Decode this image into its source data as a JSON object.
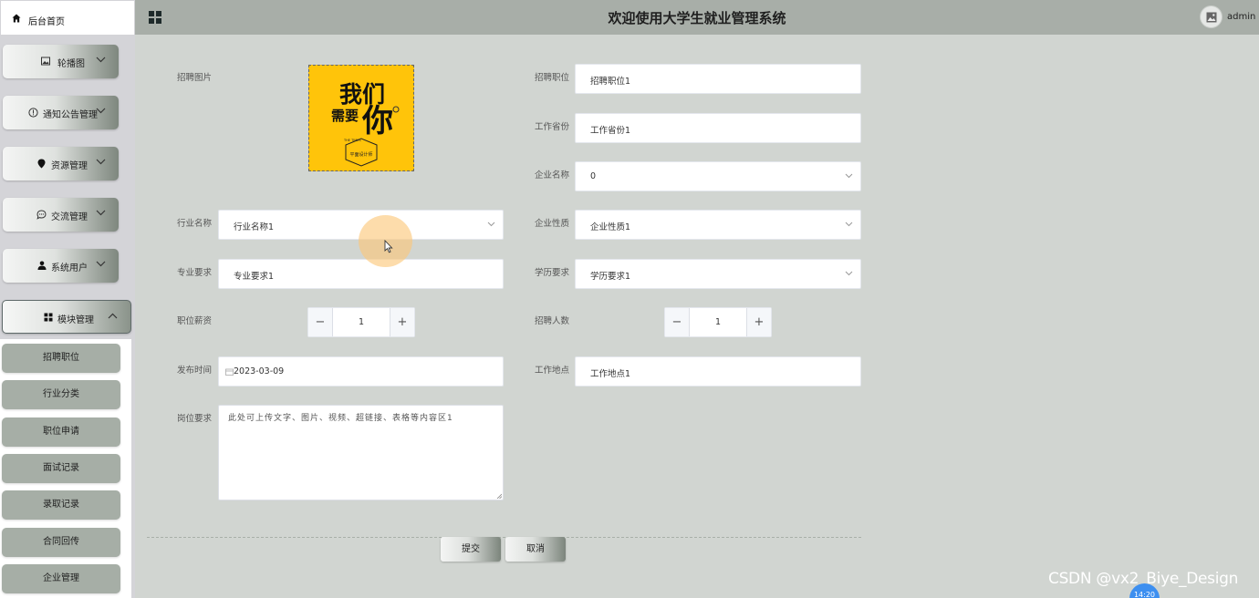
{
  "header": {
    "title": "欢迎使用大学生就业管理系统",
    "user": "admin"
  },
  "sidebar": {
    "home": "后台首页",
    "menus": [
      {
        "label": "轮播图",
        "icon": "image-icon"
      },
      {
        "label": "通知公告管理",
        "icon": "info-icon"
      },
      {
        "label": "资源管理",
        "icon": "location-pin-icon"
      },
      {
        "label": "交流管理",
        "icon": "chat-icon"
      },
      {
        "label": "系统用户",
        "icon": "user-icon"
      },
      {
        "label": "模块管理",
        "icon": "grid-icon"
      }
    ],
    "submenu": [
      "招聘职位",
      "行业分类",
      "职位申请",
      "面试记录",
      "录取记录",
      "合同回传",
      "企业管理"
    ]
  },
  "form": {
    "labels": {
      "image": "招聘图片",
      "position": "招聘职位",
      "province": "工作省份",
      "company": "企业名称",
      "industry": "行业名称",
      "nature": "企业性质",
      "major": "专业要求",
      "education": "学历要求",
      "salary": "职位薪资",
      "headcount": "招聘人数",
      "publish": "发布时间",
      "location": "工作地点",
      "requirement": "岗位要求"
    },
    "values": {
      "position": "招聘职位1",
      "province": "工作省份1",
      "company": "0",
      "industry": "行业名称1",
      "nature": "企业性质1",
      "major": "专业要求1",
      "education": "学历要求1",
      "salary": "1",
      "headcount": "1",
      "publish": "2023-03-09",
      "location": "工作地点1",
      "requirement": "此处可上传文字、图片、视频、超链接、表格等内容区1"
    },
    "poster": {
      "line1": "我们",
      "line2": "需要",
      "line3": "你",
      "small": "THE TIMES",
      "tag": "平面设计师"
    },
    "buttons": {
      "submit": "提交",
      "cancel": "取消"
    }
  },
  "overlay": {
    "watermark": "CSDN @vx2_Biye_Design",
    "clock": "14:20"
  },
  "colors": {
    "header": "#a8aea8",
    "content": "#d1d5d1",
    "sidebar": "#d4d4d8",
    "submenu_button": "#a6aea6",
    "poster": "#ffc40a"
  }
}
